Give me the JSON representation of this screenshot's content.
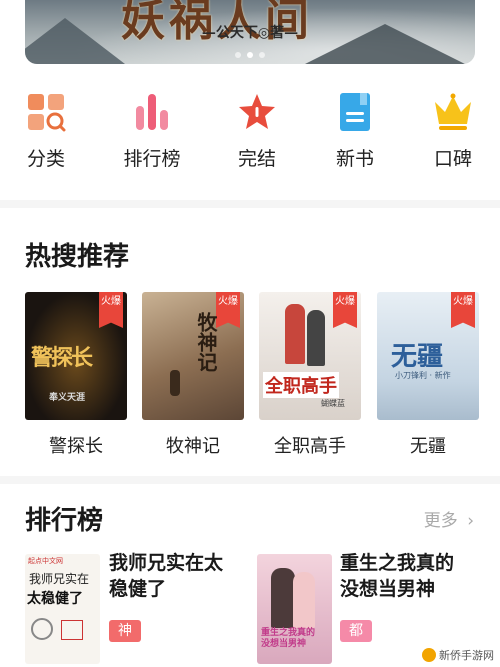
{
  "banner": {
    "title_art": "妖祸人间",
    "author": "—公天下◎著—",
    "dot_count": 3,
    "active_dot": 1
  },
  "categories": [
    {
      "label": "分类",
      "icon": "category-icon",
      "color": "#f08c5c"
    },
    {
      "label": "排行榜",
      "icon": "ranking-bars-icon",
      "color": "#ee5d78"
    },
    {
      "label": "完结",
      "icon": "star-icon",
      "color": "#e84d3d"
    },
    {
      "label": "新书",
      "icon": "new-book-icon",
      "color": "#37a8e8"
    },
    {
      "label": "口碑",
      "icon": "crown-icon",
      "color": "#f7c21a"
    }
  ],
  "hot": {
    "title": "热搜推荐",
    "books": [
      {
        "name": "警探长",
        "badge": "火爆",
        "cover_text": "警探长",
        "cover_sub": "奉义天涯",
        "bg": "#1a1410"
      },
      {
        "name": "牧神记",
        "badge": "火爆",
        "cover_text": "牧神记",
        "bg": "#a88b6c"
      },
      {
        "name": "全职高手",
        "badge": "火爆",
        "cover_text": "全职高手",
        "cover_sub": "蝴蝶蓝",
        "bg": "#e9e4df"
      },
      {
        "name": "无疆",
        "badge": "火爆",
        "cover_text": "无疆",
        "cover_sub": "小刀锋利 · 新作",
        "bg": "#d8e4ee"
      }
    ]
  },
  "rank": {
    "title": "排行榜",
    "more_label": "更多",
    "items": [
      {
        "title_line1": "我师兄实在太",
        "title_line2": "稳健了",
        "tag": "神话修真",
        "tag_color": "#f26b6b",
        "cover_line1": "我师兄实在",
        "cover_line2": "太稳健了",
        "cover_badge": "起点中文网"
      },
      {
        "title_line1": "重生之我真的",
        "title_line2": "没想当男神",
        "tag": "都市生活",
        "tag_color": "#f58aa8",
        "cover_line1": "重生之我真的",
        "cover_line2": "没想当男神"
      }
    ]
  },
  "watermark": "新侨手游网"
}
